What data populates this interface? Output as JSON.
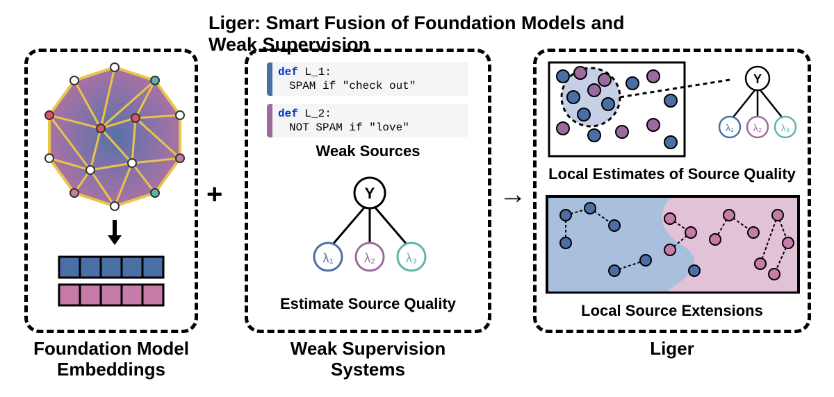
{
  "title": "Liger: Smart Fusion of Foundation Models and Weak Supervision",
  "panels": {
    "left": {
      "label": "Foundation Model\nEmbeddings"
    },
    "mid": {
      "label": "Weak Supervision\nSystems"
    },
    "right": {
      "label": "Liger"
    }
  },
  "symbols": {
    "plus": "+",
    "arrow": "→"
  },
  "code": {
    "l1": {
      "def": "def",
      "name": "L_1:",
      "body": "SPAM if \"check out\""
    },
    "l2": {
      "def": "def",
      "name": "L_2:",
      "body": "NOT SPAM if \"love\""
    }
  },
  "sub_labels": {
    "weak_sources": "Weak Sources",
    "est_quality": "Estimate Source Quality",
    "local_est": "Local Estimates of Source Quality",
    "local_ext": "Local Source Extensions"
  },
  "graph": {
    "y": "Y",
    "lambdas": [
      "λ₁",
      "λ₂",
      "λ₃"
    ]
  },
  "colors": {
    "blue": "#4a6fa5",
    "purple": "#9b6b9e",
    "pink": "#c77ba8",
    "teal": "#5cb5a8",
    "yellow": "#e8c547",
    "darkblue": "#2d4a6e",
    "darkpink": "#a85a8c"
  }
}
